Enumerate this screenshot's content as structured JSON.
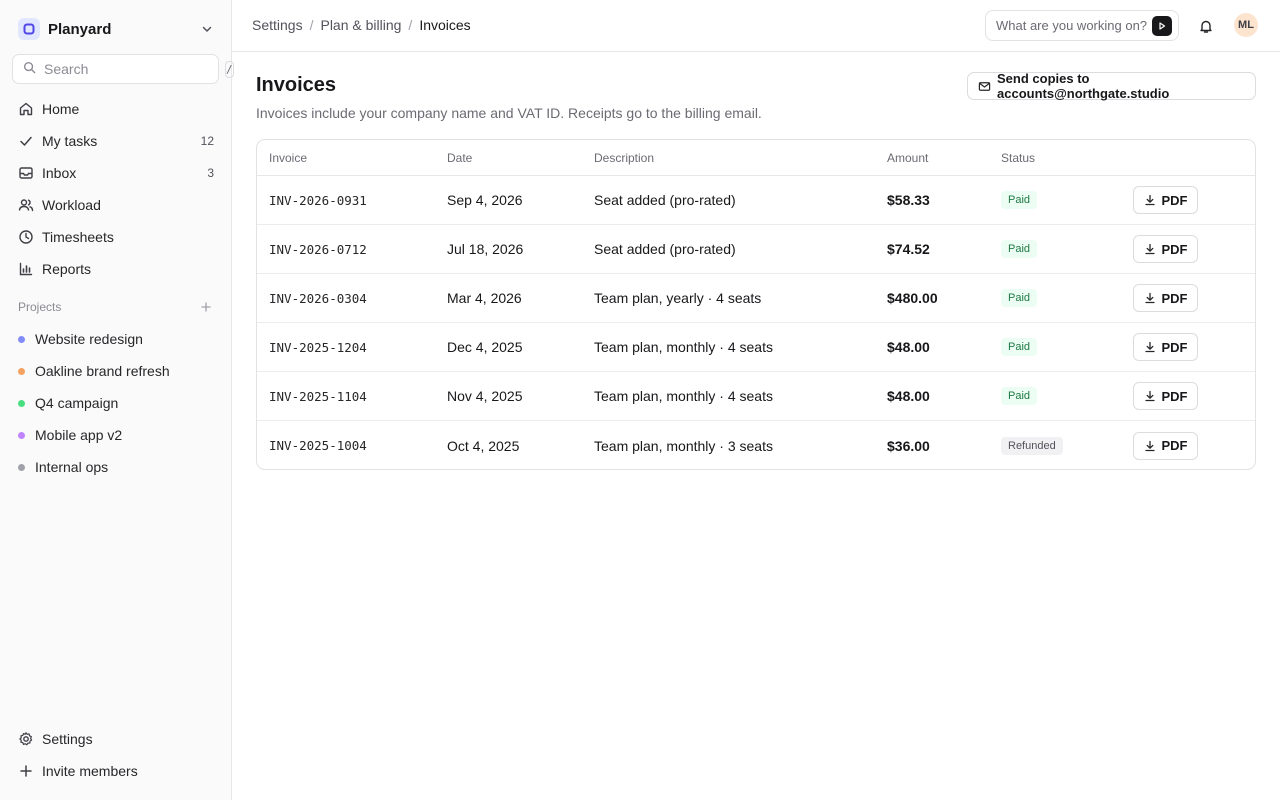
{
  "workspace": {
    "name": "Planyard"
  },
  "search": {
    "placeholder": "Search",
    "shortcut": "/"
  },
  "nav": [
    {
      "label": "Home",
      "icon": "home-icon",
      "count": ""
    },
    {
      "label": "My tasks",
      "icon": "check-icon",
      "count": "12"
    },
    {
      "label": "Inbox",
      "icon": "inbox-icon",
      "count": "3"
    },
    {
      "label": "Workload",
      "icon": "users-icon",
      "count": ""
    },
    {
      "label": "Timesheets",
      "icon": "clock-icon",
      "count": ""
    },
    {
      "label": "Reports",
      "icon": "bar-chart-icon",
      "count": ""
    }
  ],
  "projects_heading": "Projects",
  "projects": [
    {
      "label": "Website redesign",
      "color": "#818cf8"
    },
    {
      "label": "Oakline brand refresh",
      "color": "#f4a261"
    },
    {
      "label": "Q4 campaign",
      "color": "#4ade80"
    },
    {
      "label": "Mobile app v2",
      "color": "#c084fc"
    },
    {
      "label": "Internal ops",
      "color": "#a1a1aa"
    }
  ],
  "footer": {
    "settings": "Settings",
    "invite": "Invite members"
  },
  "breadcrumb": {
    "items": [
      "Settings",
      "Plan & billing"
    ],
    "current": "Invoices"
  },
  "ask": {
    "placeholder": "What are you working on?"
  },
  "user": {
    "initials": "ML"
  },
  "page": {
    "title": "Invoices",
    "subtitle": "Invoices include your company name and VAT ID. Receipts go to the billing email.",
    "send_copies": "Send copies to accounts@northgate.studio"
  },
  "table": {
    "columns": [
      "Invoice",
      "Date",
      "Description",
      "Amount",
      "Status"
    ],
    "download_label": "PDF",
    "rows": [
      {
        "invoice": "INV-2026-0931",
        "date": "Sep 4, 2026",
        "description": "Seat added (pro-rated)",
        "amount": "$58.33",
        "status": "Paid"
      },
      {
        "invoice": "INV-2026-0712",
        "date": "Jul 18, 2026",
        "description": "Seat added (pro-rated)",
        "amount": "$74.52",
        "status": "Paid"
      },
      {
        "invoice": "INV-2026-0304",
        "date": "Mar 4, 2026",
        "description": "Team plan, yearly · 4 seats",
        "amount": "$480.00",
        "status": "Paid"
      },
      {
        "invoice": "INV-2025-1204",
        "date": "Dec 4, 2025",
        "description": "Team plan, monthly · 4 seats",
        "amount": "$48.00",
        "status": "Paid"
      },
      {
        "invoice": "INV-2025-1104",
        "date": "Nov 4, 2025",
        "description": "Team plan, monthly · 4 seats",
        "amount": "$48.00",
        "status": "Paid"
      },
      {
        "invoice": "INV-2025-1004",
        "date": "Oct 4, 2025",
        "description": "Team plan, monthly · 3 seats",
        "amount": "$36.00",
        "status": "Refunded"
      }
    ]
  },
  "colors": {
    "accent": "#4f46e5",
    "paid_bg": "#ecfdf3",
    "paid_text": "#1f7a45",
    "refunded_bg": "#f1f1f3"
  }
}
